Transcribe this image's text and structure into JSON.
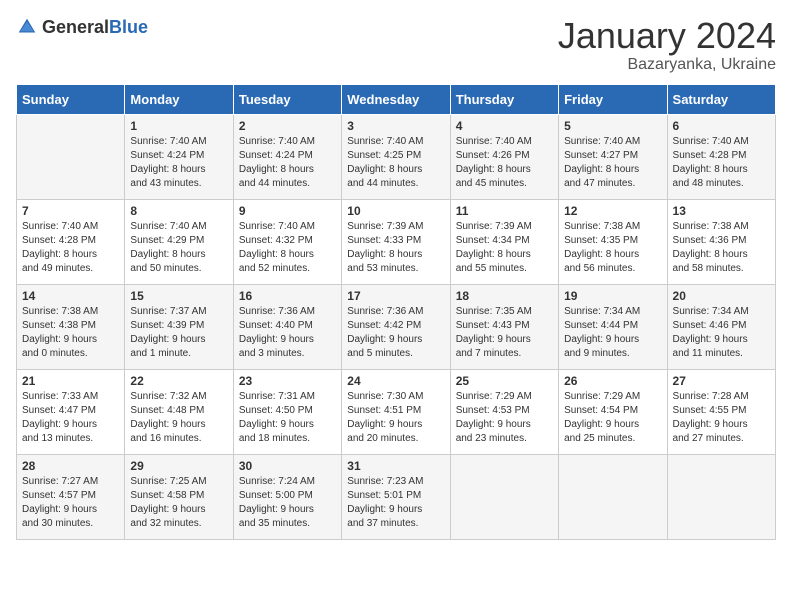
{
  "header": {
    "logo_general": "General",
    "logo_blue": "Blue",
    "month": "January 2024",
    "location": "Bazaryanka, Ukraine"
  },
  "days_of_week": [
    "Sunday",
    "Monday",
    "Tuesday",
    "Wednesday",
    "Thursday",
    "Friday",
    "Saturday"
  ],
  "weeks": [
    [
      {
        "day": "",
        "content": ""
      },
      {
        "day": "1",
        "content": "Sunrise: 7:40 AM\nSunset: 4:24 PM\nDaylight: 8 hours\nand 43 minutes."
      },
      {
        "day": "2",
        "content": "Sunrise: 7:40 AM\nSunset: 4:24 PM\nDaylight: 8 hours\nand 44 minutes."
      },
      {
        "day": "3",
        "content": "Sunrise: 7:40 AM\nSunset: 4:25 PM\nDaylight: 8 hours\nand 44 minutes."
      },
      {
        "day": "4",
        "content": "Sunrise: 7:40 AM\nSunset: 4:26 PM\nDaylight: 8 hours\nand 45 minutes."
      },
      {
        "day": "5",
        "content": "Sunrise: 7:40 AM\nSunset: 4:27 PM\nDaylight: 8 hours\nand 47 minutes."
      },
      {
        "day": "6",
        "content": "Sunrise: 7:40 AM\nSunset: 4:28 PM\nDaylight: 8 hours\nand 48 minutes."
      }
    ],
    [
      {
        "day": "7",
        "content": "Sunrise: 7:40 AM\nSunset: 4:28 PM\nDaylight: 8 hours\nand 49 minutes."
      },
      {
        "day": "8",
        "content": "Sunrise: 7:40 AM\nSunset: 4:29 PM\nDaylight: 8 hours\nand 50 minutes."
      },
      {
        "day": "9",
        "content": "Sunrise: 7:40 AM\nSunset: 4:32 PM\nDaylight: 8 hours\nand 52 minutes."
      },
      {
        "day": "10",
        "content": "Sunrise: 7:39 AM\nSunset: 4:33 PM\nDaylight: 8 hours\nand 53 minutes."
      },
      {
        "day": "11",
        "content": "Sunrise: 7:39 AM\nSunset: 4:34 PM\nDaylight: 8 hours\nand 55 minutes."
      },
      {
        "day": "12",
        "content": "Sunrise: 7:38 AM\nSunset: 4:35 PM\nDaylight: 8 hours\nand 56 minutes."
      },
      {
        "day": "13",
        "content": "Sunrise: 7:38 AM\nSunset: 4:36 PM\nDaylight: 8 hours\nand 58 minutes."
      }
    ],
    [
      {
        "day": "14",
        "content": "Sunrise: 7:38 AM\nSunset: 4:38 PM\nDaylight: 9 hours\nand 0 minutes."
      },
      {
        "day": "15",
        "content": "Sunrise: 7:37 AM\nSunset: 4:39 PM\nDaylight: 9 hours\nand 1 minute."
      },
      {
        "day": "16",
        "content": "Sunrise: 7:36 AM\nSunset: 4:40 PM\nDaylight: 9 hours\nand 3 minutes."
      },
      {
        "day": "17",
        "content": "Sunrise: 7:36 AM\nSunset: 4:42 PM\nDaylight: 9 hours\nand 5 minutes."
      },
      {
        "day": "18",
        "content": "Sunrise: 7:35 AM\nSunset: 4:43 PM\nDaylight: 9 hours\nand 7 minutes."
      },
      {
        "day": "19",
        "content": "Sunrise: 7:34 AM\nSunset: 4:44 PM\nDaylight: 9 hours\nand 9 minutes."
      },
      {
        "day": "20",
        "content": "Sunrise: 7:34 AM\nSunset: 4:46 PM\nDaylight: 9 hours\nand 11 minutes."
      }
    ],
    [
      {
        "day": "21",
        "content": "Sunrise: 7:33 AM\nSunset: 4:47 PM\nDaylight: 9 hours\nand 13 minutes."
      },
      {
        "day": "22",
        "content": "Sunrise: 7:32 AM\nSunset: 4:48 PM\nDaylight: 9 hours\nand 16 minutes."
      },
      {
        "day": "23",
        "content": "Sunrise: 7:31 AM\nSunset: 4:50 PM\nDaylight: 9 hours\nand 18 minutes."
      },
      {
        "day": "24",
        "content": "Sunrise: 7:30 AM\nSunset: 4:51 PM\nDaylight: 9 hours\nand 20 minutes."
      },
      {
        "day": "25",
        "content": "Sunrise: 7:29 AM\nSunset: 4:53 PM\nDaylight: 9 hours\nand 23 minutes."
      },
      {
        "day": "26",
        "content": "Sunrise: 7:29 AM\nSunset: 4:54 PM\nDaylight: 9 hours\nand 25 minutes."
      },
      {
        "day": "27",
        "content": "Sunrise: 7:28 AM\nSunset: 4:55 PM\nDaylight: 9 hours\nand 27 minutes."
      }
    ],
    [
      {
        "day": "28",
        "content": "Sunrise: 7:27 AM\nSunset: 4:57 PM\nDaylight: 9 hours\nand 30 minutes."
      },
      {
        "day": "29",
        "content": "Sunrise: 7:25 AM\nSunset: 4:58 PM\nDaylight: 9 hours\nand 32 minutes."
      },
      {
        "day": "30",
        "content": "Sunrise: 7:24 AM\nSunset: 5:00 PM\nDaylight: 9 hours\nand 35 minutes."
      },
      {
        "day": "31",
        "content": "Sunrise: 7:23 AM\nSunset: 5:01 PM\nDaylight: 9 hours\nand 37 minutes."
      },
      {
        "day": "",
        "content": ""
      },
      {
        "day": "",
        "content": ""
      },
      {
        "day": "",
        "content": ""
      }
    ]
  ]
}
